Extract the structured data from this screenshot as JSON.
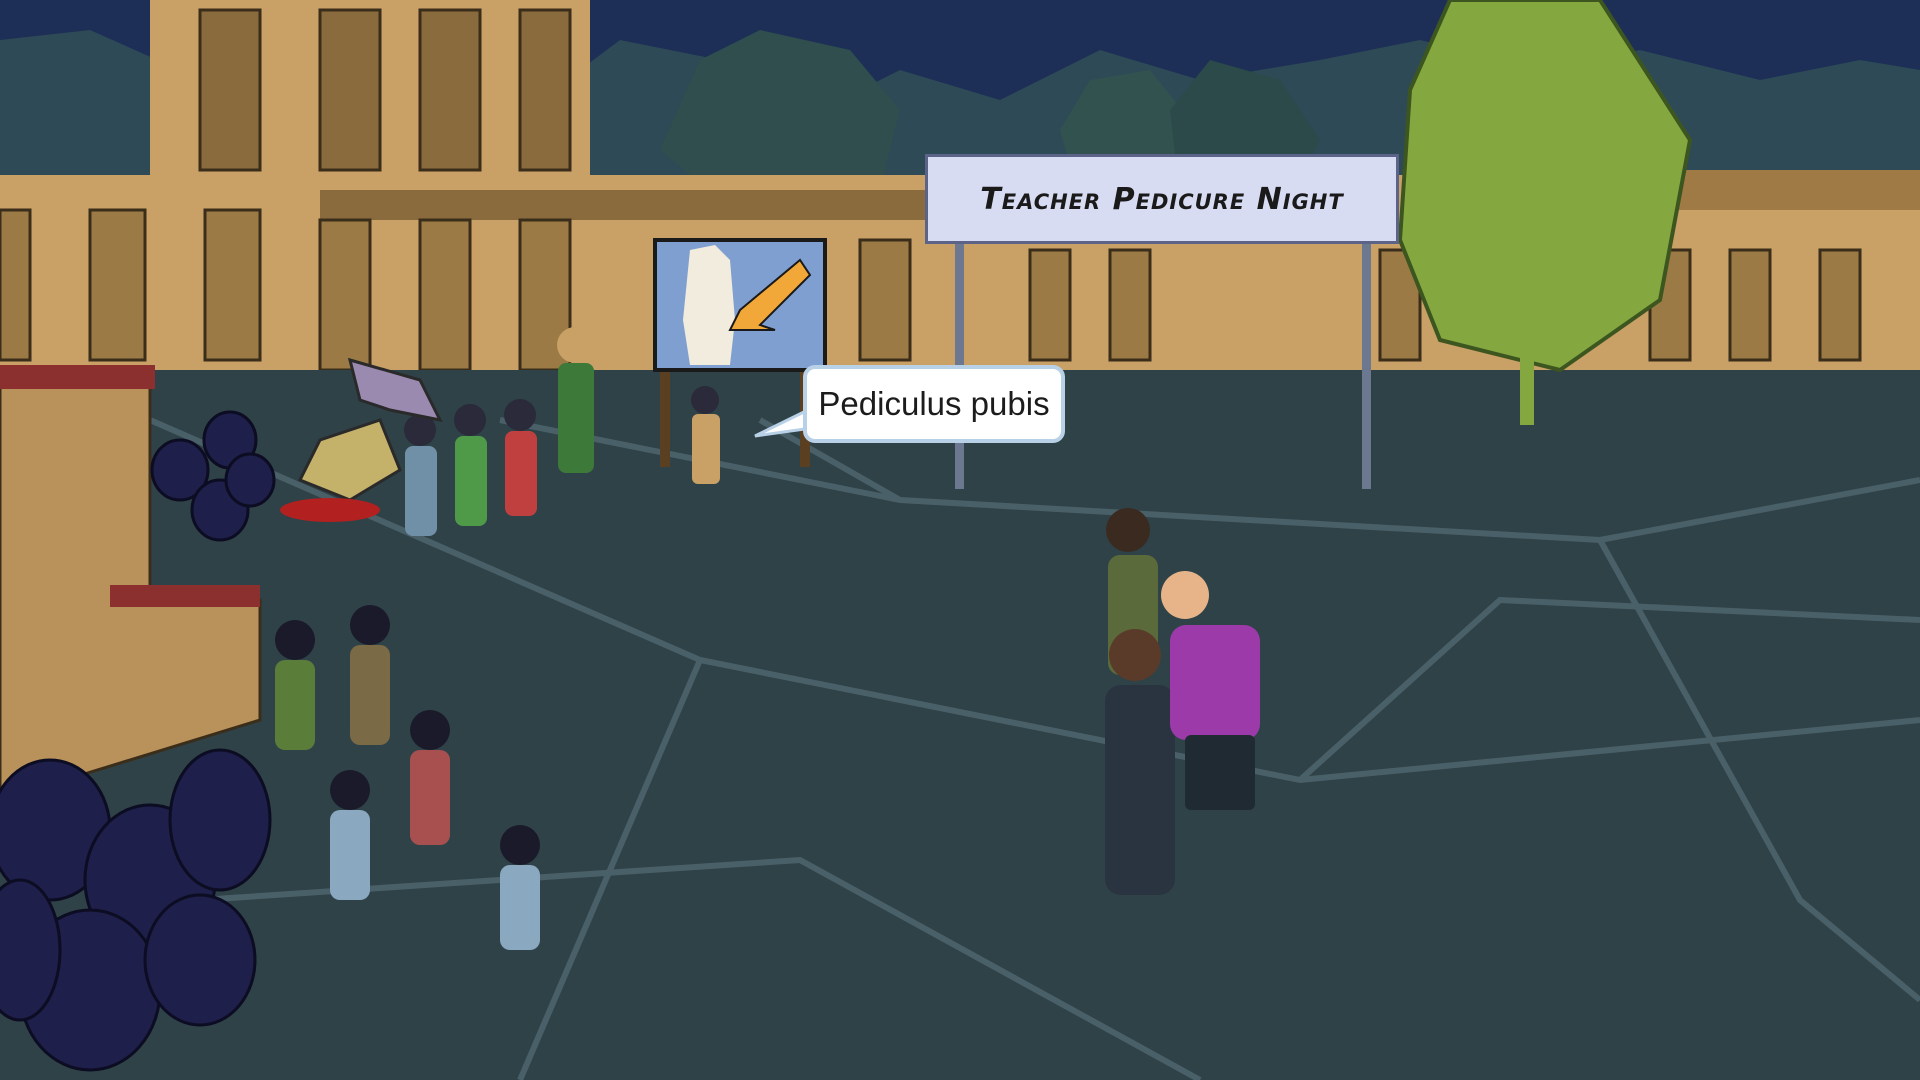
{
  "scene": {
    "banner_text": "Teacher Pedicure Night",
    "speech_bubble_text": "Pediculus pubis"
  },
  "colors": {
    "night_sky": "#1d2f57",
    "building": "#c9a065",
    "courtyard": "#2f4248",
    "banner_bg": "#d7dcf3",
    "tree": "#84a83f"
  }
}
